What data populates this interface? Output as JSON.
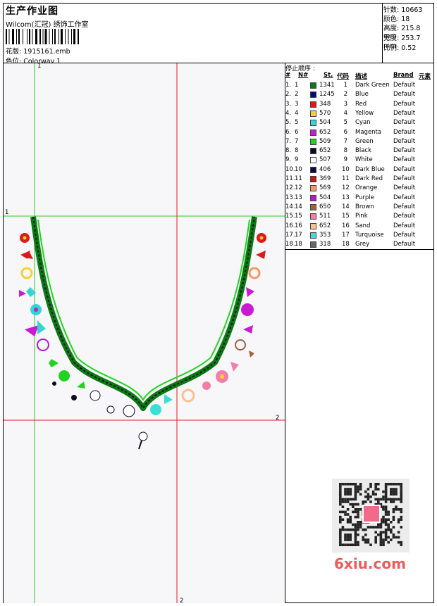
{
  "header": {
    "title": "生产作业图",
    "company": "Wilcom(汇冠) 绣饰工作室",
    "design_label": "花版:",
    "design_value": "1915161.emb",
    "colorway_label": "色位:",
    "colorway_value": "Colorway 1"
  },
  "stats": {
    "stitches_label": "针数:",
    "stitches_value": "10663",
    "colors_label": "颜色:",
    "colors_value": "18",
    "height_label": "高度:",
    "height_value": "215.8 mm",
    "width_label": "宽度:",
    "width_value": "253.7 mm",
    "scale_label": "比例:",
    "scale_value": "0.52"
  },
  "stop_table": {
    "title": "停止顺序 :",
    "headers": {
      "num": "#",
      "n": "N#",
      "stitches": "St.",
      "code": "代码",
      "description": "描述",
      "brand": "Brand",
      "element": "元素"
    },
    "rows": [
      {
        "num": "1.",
        "n": "1",
        "st": "1341",
        "code": "1",
        "desc": "Dark Green",
        "brand": "Default",
        "color": "#0b7a12"
      },
      {
        "num": "2.",
        "n": "2",
        "st": "1245",
        "code": "2",
        "desc": "Blue",
        "brand": "Default",
        "color": "#0a0a70"
      },
      {
        "num": "3.",
        "n": "3",
        "st": "348",
        "code": "3",
        "desc": "Red",
        "brand": "Default",
        "color": "#dd1a1a"
      },
      {
        "num": "4.",
        "n": "4",
        "st": "570",
        "code": "4",
        "desc": "Yellow",
        "brand": "Default",
        "color": "#f3d133"
      },
      {
        "num": "5.",
        "n": "5",
        "st": "504",
        "code": "5",
        "desc": "Cyan",
        "brand": "Default",
        "color": "#33d6cf"
      },
      {
        "num": "6.",
        "n": "6",
        "st": "652",
        "code": "6",
        "desc": "Magenta",
        "brand": "Default",
        "color": "#c91ad4"
      },
      {
        "num": "7.",
        "n": "7",
        "st": "509",
        "code": "7",
        "desc": "Green",
        "brand": "Default",
        "color": "#21d421"
      },
      {
        "num": "8.",
        "n": "8",
        "st": "652",
        "code": "8",
        "desc": "Black",
        "brand": "Default",
        "color": "#0c0c22"
      },
      {
        "num": "9.",
        "n": "9",
        "st": "507",
        "code": "9",
        "desc": "White",
        "brand": "Default",
        "color": "#ffffff"
      },
      {
        "num": "10.",
        "n": "10",
        "st": "406",
        "code": "10",
        "desc": "Dark Blue",
        "brand": "Default",
        "color": "#0a0a3a"
      },
      {
        "num": "11.",
        "n": "11",
        "st": "369",
        "code": "11",
        "desc": "Dark Red",
        "brand": "Default",
        "color": "#c41818"
      },
      {
        "num": "12.",
        "n": "12",
        "st": "569",
        "code": "12",
        "desc": "Orange",
        "brand": "Default",
        "color": "#f59a66"
      },
      {
        "num": "13.",
        "n": "13",
        "st": "504",
        "code": "13",
        "desc": "Purple",
        "brand": "Default",
        "color": "#b01ad0"
      },
      {
        "num": "14.",
        "n": "14",
        "st": "650",
        "code": "14",
        "desc": "Brown",
        "brand": "Default",
        "color": "#a06040"
      },
      {
        "num": "15.",
        "n": "15",
        "st": "511",
        "code": "15",
        "desc": "Pink",
        "brand": "Default",
        "color": "#f27fa8"
      },
      {
        "num": "16.",
        "n": "16",
        "st": "652",
        "code": "16",
        "desc": "Sand",
        "brand": "Default",
        "color": "#f7c28f"
      },
      {
        "num": "17.",
        "n": "17",
        "st": "353",
        "code": "17",
        "desc": "Turquoise",
        "brand": "Default",
        "color": "#3ae0d6"
      },
      {
        "num": "18.",
        "n": "18",
        "st": "318",
        "code": "18",
        "desc": "Grey",
        "brand": "Default",
        "color": "#666666"
      }
    ]
  },
  "canvas": {
    "guide_labels": {
      "top_green": "1",
      "left_green": "1",
      "right_red": "2",
      "bottom_red": "2"
    },
    "guide_colors": {
      "green": "#22cc22",
      "red": "#dd2222"
    }
  },
  "watermark": {
    "text": "6xiu.com"
  }
}
